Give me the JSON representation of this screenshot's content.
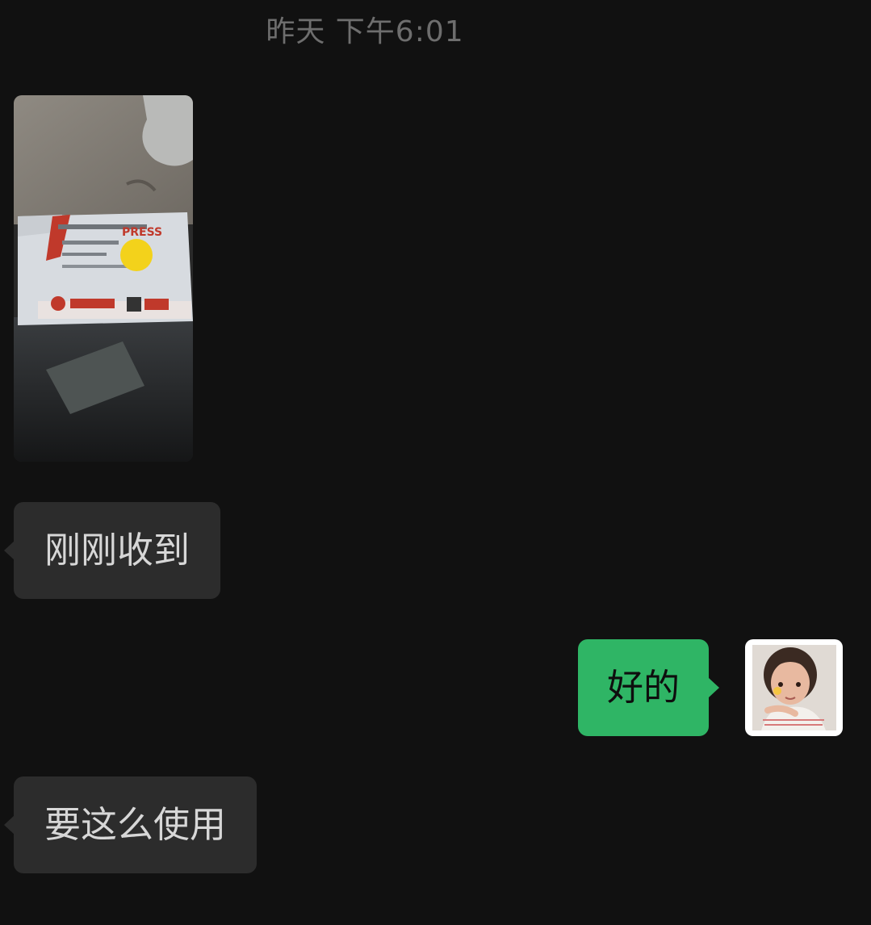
{
  "chat": {
    "timestamp": "昨天 下午6:01",
    "messages": [
      {
        "direction": "incoming",
        "type": "image",
        "alt_icon": "photo-of-express-parcel"
      },
      {
        "direction": "incoming",
        "type": "text",
        "text": "刚刚收到"
      },
      {
        "direction": "outgoing",
        "type": "text",
        "text": "好的"
      },
      {
        "direction": "incoming",
        "type": "text",
        "text": "要这么使用"
      }
    ],
    "photo_label": "PRESS"
  },
  "colors": {
    "background": "#111111",
    "incoming_bubble": "#2c2c2c",
    "outgoing_bubble": "#2fb565",
    "timestamp_text": "#6e6e6e"
  },
  "icons": {
    "avatar": "user-avatar-photo"
  }
}
